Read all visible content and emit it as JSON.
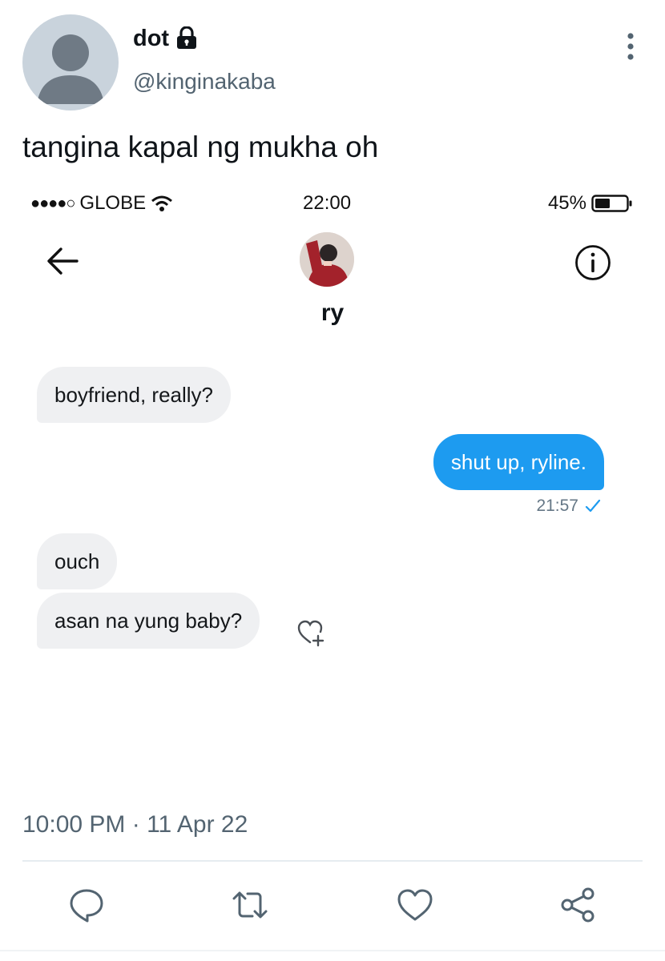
{
  "tweet": {
    "display_name": "dot",
    "handle": "@kinginakaba",
    "text": "tangina kapal ng mukha oh",
    "timestamp": "10:00 PM · 11 Apr 22",
    "icons": [
      "avatar-placeholder",
      "lock-icon",
      "more-vertical-icon"
    ]
  },
  "screenshot": {
    "status_bar": {
      "signal": "●●●●○",
      "carrier": "GLOBE",
      "time": "22:00",
      "battery": "45%"
    },
    "chat_header": {
      "contact_name": "ry",
      "icons": [
        "back-arrow-icon",
        "info-icon"
      ]
    },
    "messages": [
      {
        "direction": "incoming",
        "text": "boyfriend, really?"
      },
      {
        "direction": "outgoing",
        "text": "shut up, ryline.",
        "time": "21:57",
        "status": "read-check"
      },
      {
        "direction": "incoming",
        "text": "ouch"
      },
      {
        "direction": "incoming",
        "text": "asan na yung baby?"
      }
    ],
    "colors": {
      "outgoing_bubble": "#1d9bf0",
      "incoming_bubble": "#eff0f2"
    }
  },
  "actions": [
    "reply-icon",
    "retweet-icon",
    "like-icon",
    "share-icon"
  ]
}
